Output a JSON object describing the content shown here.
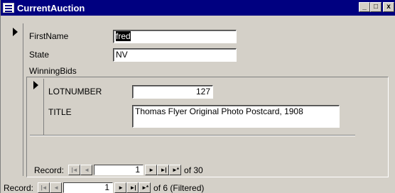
{
  "window": {
    "title": "CurrentAuction",
    "buttons": {
      "minimize": "_",
      "maximize": "□",
      "close": "x"
    }
  },
  "main": {
    "fields": {
      "firstname_label": "FirstName",
      "firstname_value": "fred",
      "state_label": "State",
      "state_value": "NV"
    },
    "subform_label": "WinningBids"
  },
  "subform": {
    "lotnumber_label": "LOTNUMBER",
    "lotnumber_value": "127",
    "title_label": "TITLE",
    "title_value": "Thomas Flyer Original Photo Postcard, 1908",
    "nav": {
      "label": "Record:",
      "current": "1",
      "total_text": "of 30"
    }
  },
  "outer_nav": {
    "label": "Record:",
    "current": "1",
    "total_text": "of 6 (Filtered)"
  },
  "nav_icons": {
    "first": "|◄",
    "prev": "◄",
    "next": "►",
    "last": "►|",
    "new": "►*"
  }
}
